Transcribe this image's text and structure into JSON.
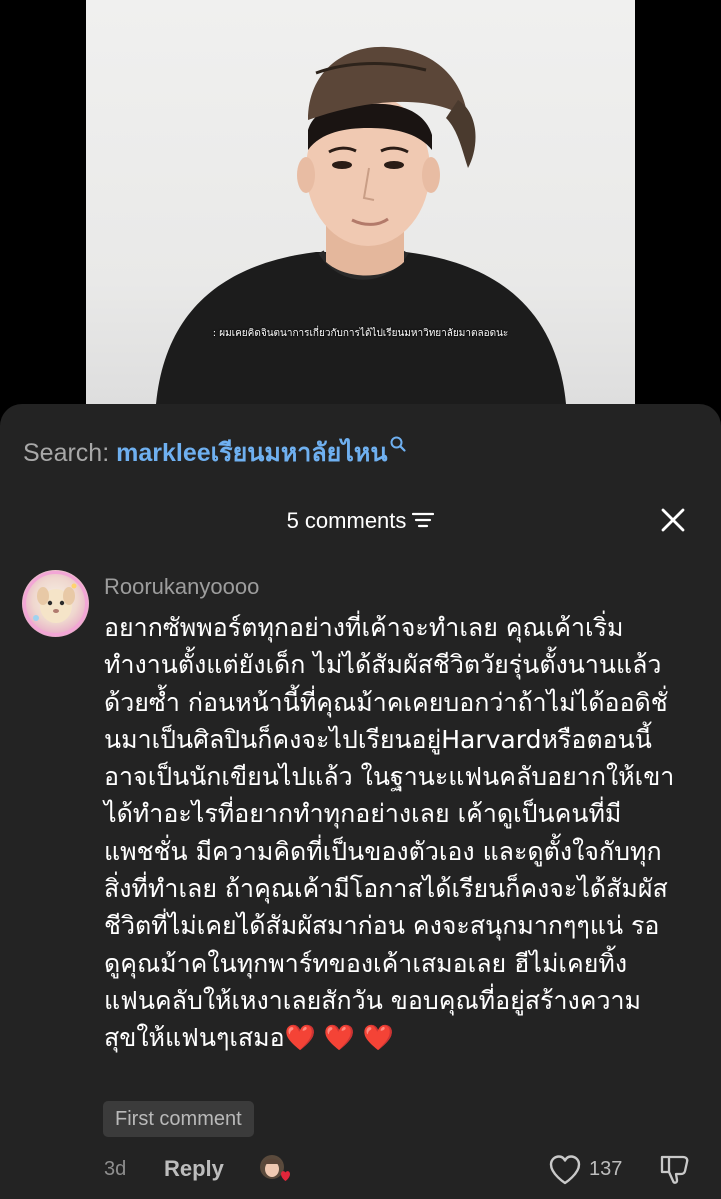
{
  "video": {
    "subtitle": ": ผมเคยคิดจินตนาการเกี่ยวกับการได้ไปเรียนมหาวิทยาลัยมาตลอดนะ"
  },
  "search": {
    "prefix": "Search: ",
    "query": "markleeเรียนมหาลัยไหน",
    "icon": "search-icon"
  },
  "comments": {
    "header": "5 comments",
    "sort_icon": "sort-icon",
    "close_icon": "close-icon"
  },
  "comment": {
    "username": "Roorukanyoooo",
    "lines": [
      "อยากซัพพอร์ตทุกอย่างที่เค้าจะทำเลย คุณเค้าเริ่ม",
      "ทำงานตั้งแต่ยังเด็ก ไม่ได้สัมผัสชีวิตวัยรุ่นตั้งนานแล้ว",
      "ด้วยซ้ำ ก่อนหน้านี้ที่คุณม้าคเคยบอกว่าถ้าไม่ได้ออดิชั่",
      "นมาเป็นศิลปินก็คงจะไปเรียนอยู่Harvardหรือตอนนี้",
      "อาจเป็นนักเขียนไปแล้ว ในฐานะแฟนคลับอยากให้เขา",
      "ได้ทำอะไรที่อยากทำทุกอย่างเลย เค้าดูเป็นคนที่มี",
      "แพชชั่น มีความคิดที่เป็นของตัวเอง และดูตั้งใจกับทุก",
      "สิ่งที่ทำเลย ถ้าคุณเค้ามีโอกาสได้เรียนก็คงจะได้สัมผัส",
      "ชีวิตที่ไม่เคยได้สัมผัสมาก่อน คงจะสนุกมากๆๆแน่ รอ",
      "ดูคุณม้าคในทุกพาร์ทของเค้าเสมอเลย ฮีไม่เคยทิ้ง",
      "แฟนคลับให้เหงาเลยสักวัน ขอบคุณที่อยู่สร้างความ",
      "สุขให้แฟนๆเสมอ❤️ ❤️ ❤️"
    ],
    "badge": "First comment",
    "time": "3d",
    "reply_label": "Reply",
    "like_count": "137",
    "like_icon": "heart-outline-icon",
    "dislike_icon": "dislike-icon",
    "creator_like_icon": "creator-liked-icon"
  },
  "colors": {
    "sheet_bg": "#232323",
    "search_query": "#6fb0f0",
    "heart": "#e0263a"
  }
}
